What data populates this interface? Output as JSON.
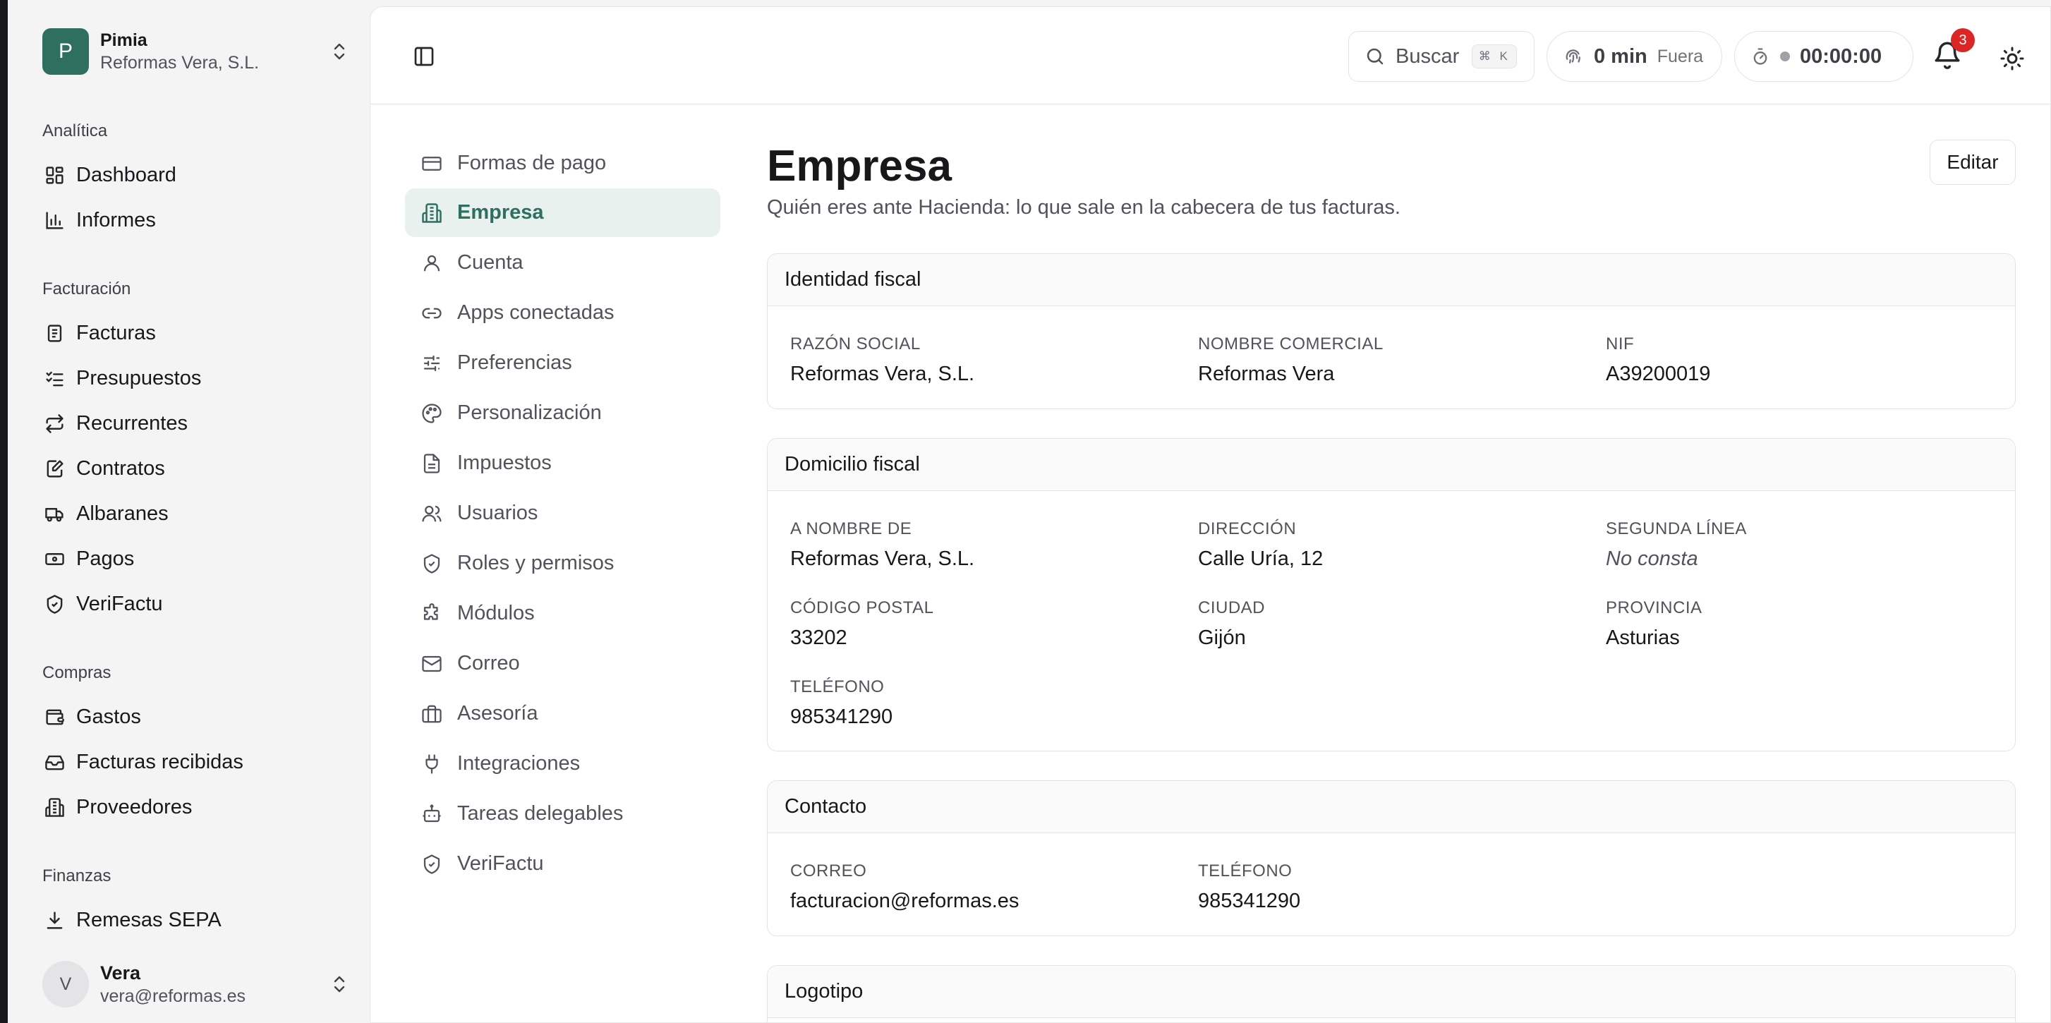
{
  "org": {
    "initial": "P",
    "name": "Pimia",
    "company": "Reformas Vera, S.L."
  },
  "sidebar": {
    "sections": [
      {
        "title": "Analítica",
        "items": [
          {
            "label": "Dashboard",
            "icon": "dashboard-icon"
          },
          {
            "label": "Informes",
            "icon": "bar-chart-icon"
          }
        ]
      },
      {
        "title": "Facturación",
        "items": [
          {
            "label": "Facturas",
            "icon": "invoice-icon"
          },
          {
            "label": "Presupuestos",
            "icon": "checklist-icon"
          },
          {
            "label": "Recurrentes",
            "icon": "repeat-icon"
          },
          {
            "label": "Contratos",
            "icon": "contract-icon"
          },
          {
            "label": "Albaranes",
            "icon": "truck-icon"
          },
          {
            "label": "Pagos",
            "icon": "banknote-icon"
          },
          {
            "label": "VeriFactu",
            "icon": "shield-check-icon"
          }
        ]
      },
      {
        "title": "Compras",
        "items": [
          {
            "label": "Gastos",
            "icon": "wallet-icon"
          },
          {
            "label": "Facturas recibidas",
            "icon": "inbox-icon"
          },
          {
            "label": "Proveedores",
            "icon": "building-icon"
          }
        ]
      },
      {
        "title": "Finanzas",
        "items": [
          {
            "label": "Remesas SEPA",
            "icon": "download-icon"
          }
        ]
      }
    ]
  },
  "user": {
    "initial": "V",
    "name": "Vera",
    "email": "vera@reformas.es"
  },
  "topbar": {
    "search_label": "Buscar",
    "search_shortcut": "⌘ K",
    "clock_value": "0 min",
    "clock_status": "Fuera",
    "timer": "00:00:00",
    "notifications_count": "3"
  },
  "settings_nav": [
    {
      "label": "Formas de pago",
      "icon": "credit-card-icon",
      "active": false
    },
    {
      "label": "Empresa",
      "icon": "building-icon",
      "active": true
    },
    {
      "label": "Cuenta",
      "icon": "user-icon",
      "active": false
    },
    {
      "label": "Apps conectadas",
      "icon": "link-icon",
      "active": false
    },
    {
      "label": "Preferencias",
      "icon": "sliders-icon",
      "active": false
    },
    {
      "label": "Personalización",
      "icon": "palette-icon",
      "active": false
    },
    {
      "label": "Impuestos",
      "icon": "document-icon",
      "active": false
    },
    {
      "label": "Usuarios",
      "icon": "users-icon",
      "active": false
    },
    {
      "label": "Roles y permisos",
      "icon": "shield-check-icon",
      "active": false
    },
    {
      "label": "Módulos",
      "icon": "puzzle-icon",
      "active": false
    },
    {
      "label": "Correo",
      "icon": "mail-icon",
      "active": false
    },
    {
      "label": "Asesoría",
      "icon": "briefcase-icon",
      "active": false
    },
    {
      "label": "Integraciones",
      "icon": "plug-icon",
      "active": false
    },
    {
      "label": "Tareas delegables",
      "icon": "bot-icon",
      "active": false
    },
    {
      "label": "VeriFactu",
      "icon": "shield-check-icon",
      "active": false
    }
  ],
  "page": {
    "title": "Empresa",
    "subtitle": "Quién eres ante Hacienda: lo que sale en la cabecera de tus facturas.",
    "edit_label": "Editar"
  },
  "cards": {
    "fiscal_identity": {
      "title": "Identidad fiscal",
      "fields": [
        {
          "label": "RAZÓN SOCIAL",
          "value": "Reformas Vera, S.L."
        },
        {
          "label": "NOMBRE COMERCIAL",
          "value": "Reformas Vera"
        },
        {
          "label": "NIF",
          "value": "A39200019"
        }
      ]
    },
    "fiscal_address": {
      "title": "Domicilio fiscal",
      "fields": [
        {
          "label": "A NOMBRE DE",
          "value": "Reformas Vera, S.L."
        },
        {
          "label": "DIRECCIÓN",
          "value": "Calle Uría, 12"
        },
        {
          "label": "SEGUNDA LÍNEA",
          "value": "No consta"
        },
        {
          "label": "CÓDIGO POSTAL",
          "value": "33202"
        },
        {
          "label": "CIUDAD",
          "value": "Gijón"
        },
        {
          "label": "PROVINCIA",
          "value": "Asturias"
        },
        {
          "label": "TELÉFONO",
          "value": "985341290"
        }
      ]
    },
    "contact": {
      "title": "Contacto",
      "fields": [
        {
          "label": "CORREO",
          "value": "facturacion@reformas.es"
        },
        {
          "label": "TELÉFONO",
          "value": "985341290"
        }
      ]
    },
    "logo": {
      "title": "Logotipo"
    }
  },
  "colors": {
    "accent": "#2f6f60",
    "accent_bg": "#e8f1ee",
    "badge": "#dc2626"
  }
}
